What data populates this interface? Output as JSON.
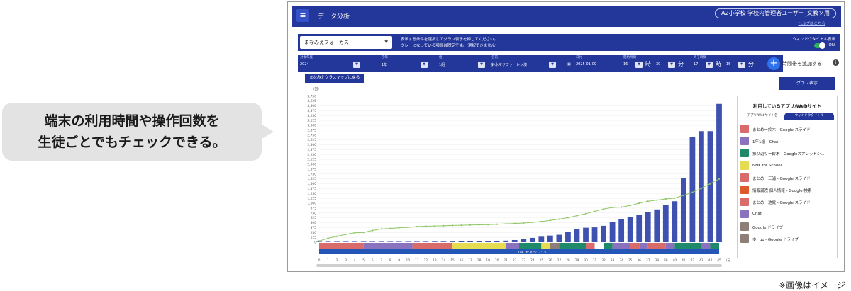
{
  "caption": {
    "line1": "端末の利用時間や操作回数を",
    "line2": "生徒ごとでもチェックできる。"
  },
  "note": "※画像はイメージ",
  "appbar": {
    "menu_icon": "hamburger-icon",
    "title": "データ分析",
    "user": "A2小学校 学校内管理者ユーザー_文教ソ用",
    "help": "ヘルプはこちら"
  },
  "controls": {
    "mode": "まなみえフォーカス",
    "hint_line1": "表示する条件を選択してグラフ表示を押してください。",
    "hint_line2": "グレーになっている項目は固定です。(選択できません)",
    "window_title_label": "ウィンドウタイトル表示",
    "toggle_state": "ON"
  },
  "filters": {
    "year_label": "対象年度",
    "year": "2024",
    "grade_label": "学年",
    "grade": "1年",
    "class_label": "組",
    "class": "1組",
    "name_label": "名前",
    "name": "鈴木マクファーレン湊",
    "date_label": "日付",
    "date": "2025-01-09",
    "start_label": "開始時間",
    "start_hour": "16",
    "start_min": "30",
    "end_label": "終了時間",
    "end_hour": "17",
    "end_min": "15",
    "hour_unit": "時",
    "min_unit": "分",
    "add_label": "時間帯を追加する",
    "add_icon": "plus-icon",
    "info_icon": "info-icon"
  },
  "back_button": "まなみえクラスマップに戻る",
  "graph_button": "グラフ表示",
  "chart_data": {
    "type": "bar",
    "ylabel": "(回)",
    "xlabel": "(分)",
    "ylim": [
      0,
      3800
    ],
    "yticks": [
      0,
      125,
      250,
      375,
      500,
      625,
      750,
      875,
      1000,
      1125,
      1250,
      1375,
      1500,
      1625,
      1750,
      1875,
      2000,
      2125,
      2250,
      2375,
      2500,
      2625,
      2750,
      2875,
      3000,
      3125,
      3250,
      3375,
      3500,
      3625,
      3750
    ],
    "ytick_labels": [
      "0",
      "125",
      "250",
      "375",
      "500",
      "625",
      "750",
      "875",
      "1,000",
      "1,125",
      "1,250",
      "1,375",
      "1,500",
      "1,625",
      "1,750",
      "1,875",
      "2,000",
      "2,125",
      "2,250",
      "2,375",
      "2,500",
      "2,625",
      "2,750",
      "2,875",
      "3,000",
      "3,125",
      "3,250",
      "3,375",
      "3,500",
      "3,625",
      "3,750"
    ],
    "categories": [
      "0",
      "1",
      "2",
      "3",
      "4",
      "5",
      "6",
      "7",
      "8",
      "9",
      "10",
      "11",
      "12",
      "13",
      "14",
      "15",
      "16",
      "17",
      "18",
      "19",
      "20",
      "21",
      "22",
      "23",
      "24",
      "25",
      "26",
      "27",
      "28",
      "29",
      "30",
      "31",
      "32",
      "33",
      "34",
      "35",
      "36",
      "37",
      "38",
      "39",
      "40",
      "41",
      "42",
      "43",
      "44",
      "45"
    ],
    "bars": [
      2,
      3,
      4,
      5,
      6,
      7,
      8,
      9,
      9,
      10,
      10,
      11,
      12,
      13,
      14,
      16,
      18,
      20,
      22,
      25,
      30,
      40,
      55,
      80,
      110,
      140,
      170,
      190,
      260,
      340,
      370,
      380,
      420,
      510,
      590,
      640,
      700,
      780,
      840,
      950,
      1050,
      1650,
      2700,
      2850,
      2850,
      3550
    ],
    "line": [
      30,
      100,
      150,
      200,
      240,
      250,
      300,
      340,
      350,
      370,
      380,
      400,
      410,
      415,
      420,
      430,
      435,
      440,
      445,
      450,
      460,
      470,
      480,
      490,
      510,
      530,
      560,
      590,
      630,
      680,
      730,
      790,
      850,
      890,
      900,
      940,
      1000,
      1050,
      1080,
      1110,
      1130,
      1200,
      1280,
      1380,
      1500,
      1620
    ],
    "band": {
      "label": "1/9 16:30〜17:15",
      "segments": [
        {
          "from": 0,
          "to": 5,
          "color": "#d96b6b"
        },
        {
          "from": 5,
          "to": 10.5,
          "color": "#8a72bf"
        },
        {
          "from": 10.5,
          "to": 15,
          "color": "#d96b6b"
        },
        {
          "from": 15,
          "to": 21,
          "color": "#e6dc52"
        },
        {
          "from": 21,
          "to": 22.5,
          "color": "#8a72bf"
        },
        {
          "from": 22.5,
          "to": 25,
          "color": "#1e8a6a"
        },
        {
          "from": 25,
          "to": 26,
          "color": "#e6dc52"
        },
        {
          "from": 26,
          "to": 27,
          "color": "#8d7f78"
        },
        {
          "from": 27,
          "to": 30,
          "color": "#1e8a6a"
        },
        {
          "from": 30,
          "to": 31,
          "color": "#d96b6b"
        },
        {
          "from": 31,
          "to": 32,
          "color": "#ffffff"
        },
        {
          "from": 32,
          "to": 33,
          "color": "#1e8a6a"
        },
        {
          "from": 33,
          "to": 35,
          "color": "#8a72bf"
        },
        {
          "from": 35,
          "to": 36,
          "color": "#d96b6b"
        },
        {
          "from": 36,
          "to": 37,
          "color": "#8a72bf"
        },
        {
          "from": 37,
          "to": 39,
          "color": "#d96b6b"
        },
        {
          "from": 39,
          "to": 40,
          "color": "#8a72bf"
        },
        {
          "from": 40,
          "to": 43,
          "color": "#1e8a6a"
        },
        {
          "from": 43,
          "to": 44,
          "color": "#8a72bf"
        },
        {
          "from": 44,
          "to": 45,
          "color": "#1e8a6a"
        }
      ]
    },
    "colors": {
      "bar": "#3f51b0",
      "line": "#8fc765",
      "band_bar": "#2456b8"
    }
  },
  "panel": {
    "title": "利用しているアプリ/Webサイト",
    "tab_apps": "アプリ/Webサイト名",
    "tab_window": "ウィンドウタイトル",
    "items": [
      {
        "label": "まとめー鈴木 - Google スライド",
        "color": "#d96b6b"
      },
      {
        "label": "1年1組 - Chat",
        "color": "#8a72bf"
      },
      {
        "label": "振り返りー鈴木 - Googleスプレッドシ...",
        "color": "#1e8a6a"
      },
      {
        "label": "NHK for School",
        "color": "#e6dc52"
      },
      {
        "label": "まとめー三浦 - Google スライド",
        "color": "#d96b6b"
      },
      {
        "label": "情報漏洩 個人情報 - Google 検索",
        "color": "#dd5a2c"
      },
      {
        "label": "まとめー池尻 - Google スライド",
        "color": "#d96b6b"
      },
      {
        "label": "Chat",
        "color": "#8a72bf"
      },
      {
        "label": "Google ドライブ",
        "color": "#8d7f78"
      },
      {
        "label": "ホーム - Google ドライブ",
        "color": "#8d7f78"
      }
    ]
  }
}
